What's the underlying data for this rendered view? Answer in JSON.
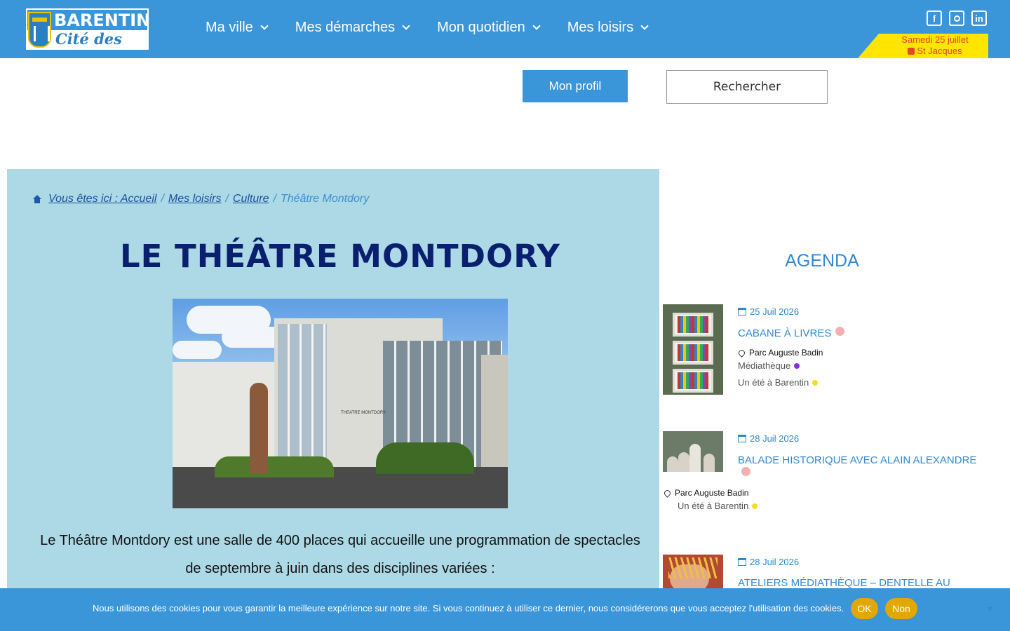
{
  "header": {
    "logo_name": "BARENTIN",
    "logo_tagline": "Cité des Arts",
    "nav": [
      {
        "label": "Ma ville"
      },
      {
        "label": "Mes démarches"
      },
      {
        "label": "Mon quotidien"
      },
      {
        "label": "Mes loisirs"
      }
    ],
    "social": {
      "facebook": "f",
      "linkedin": "in"
    },
    "date": "Samedi 25 juillet",
    "saint": "St Jacques"
  },
  "actions": {
    "profile_label": "Mon profil",
    "search_label": "Rechercher"
  },
  "breadcrumb": {
    "home": "Vous êtes ici : Accueil",
    "items": [
      "Mes loisirs",
      "Culture"
    ],
    "separator": "/",
    "current": "Théâtre Montdory"
  },
  "page": {
    "title": "LE THÉÂTRE MONTDORY",
    "photo_sign": "THEATRE MONTDORY",
    "intro": "Le Théâtre Montdory est une salle de 400 places qui accueille une programmation de spectacles de septembre à juin dans des disciplines variées :"
  },
  "agenda": {
    "title": "AGENDA",
    "events": [
      {
        "date": "25 Juil 2026",
        "title": "CABANE À LIVRES",
        "location": "Parc Auguste Badin",
        "tags": [
          "Médiathèque",
          "Un été à Barentin"
        ]
      },
      {
        "date": "28 Juil 2026",
        "title": "BALADE HISTORIQUE AVEC ALAIN ALEXANDRE",
        "location": "Parc Auguste Badin",
        "tags": [
          "Un été à Barentin"
        ]
      },
      {
        "date": "28 Juil 2026",
        "title": "ATELIERS MÉDIATHÈQUE – DENTELLE AU"
      }
    ]
  },
  "cookie": {
    "message": "Nous utilisons des cookies pour vous garantir la meilleure expérience sur notre site. Si vous continuez à utiliser ce dernier, nous considérerons que vous acceptez l'utilisation des cookies.",
    "ok_label": "OK",
    "no_label": "Non",
    "close": "×"
  },
  "colors": {
    "brand_blue": "#3b95d9",
    "content_bg": "#add8e6",
    "title_navy": "#0a1f6e",
    "date_badge": "#ffe500",
    "cookie_button": "#e0a800"
  }
}
